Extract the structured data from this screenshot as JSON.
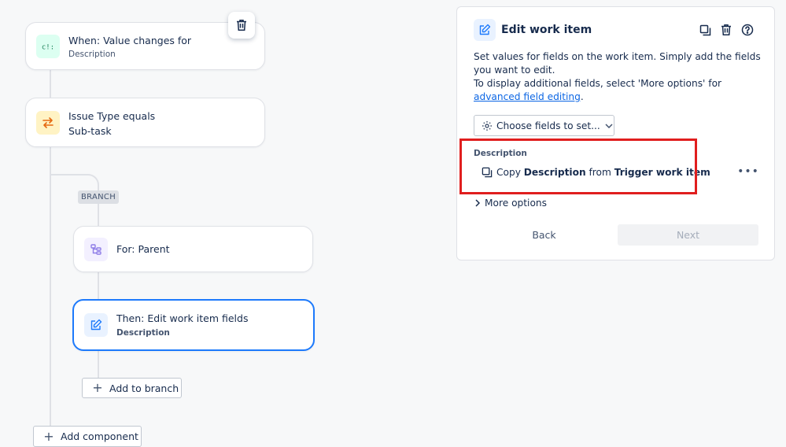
{
  "canvas": {
    "cards": [
      {
        "title": "When: Value changes for",
        "subtitle": "Description",
        "icon": "brackets-icon",
        "color": "#dcfff1"
      },
      {
        "title": "Issue Type equals",
        "subtitle": "Sub-task",
        "icon": "swap-icon",
        "color": "#fff3c4"
      },
      {
        "title": "For: Parent",
        "icon": "hierarchy-icon",
        "color": "#f3f0ff"
      },
      {
        "title": "Then: Edit work item fields",
        "subtitle": "Description",
        "icon": "edit-icon",
        "color": "#e9f2ff"
      }
    ],
    "branch_tag": "BRANCH",
    "add_to_branch": "Add to branch",
    "add_component": "Add component",
    "delete_icon": "trash-icon"
  },
  "panel": {
    "title": "Edit work item",
    "header_icons": [
      "duplicate-icon",
      "trash-icon",
      "help-icon"
    ],
    "description_line1": "Set values for fields on the work item. Simply add the fields you want to edit.",
    "description_line2": "To display additional fields, select 'More options' for ",
    "description_link": "advanced field editing",
    "description_end": ".",
    "choose_fields": "Choose fields to set...",
    "field_label": "Description",
    "copy_prefix": "Copy",
    "copy_field": "Description",
    "copy_from": "from",
    "copy_source": "Trigger work item",
    "more_options": "More options",
    "back": "Back",
    "next": "Next"
  },
  "colors": {
    "accent": "#1d7afc",
    "highlight": "#e01e1e",
    "link": "#0c66e4"
  }
}
